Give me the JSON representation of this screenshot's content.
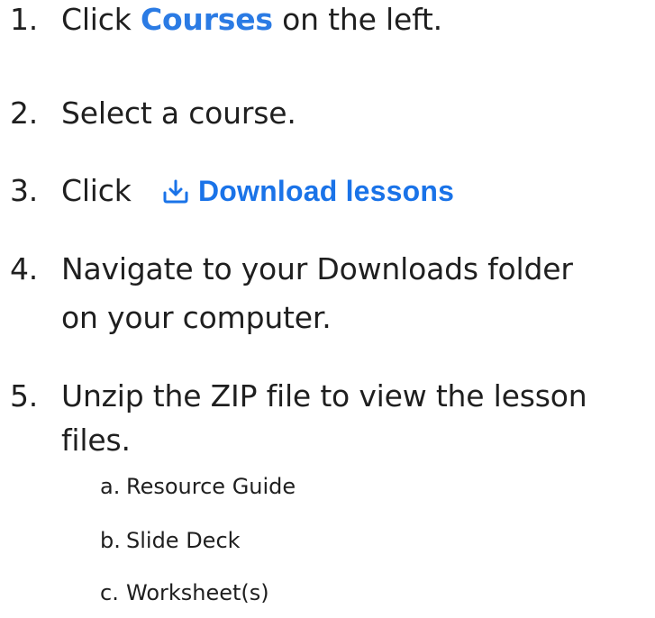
{
  "steps": [
    {
      "num": "1.",
      "pre": "Click ",
      "link": "Courses",
      "post": " on the left."
    },
    {
      "num": "2.",
      "text": "Select a course."
    },
    {
      "num": "3.",
      "text": "Click",
      "button": {
        "label": "Download lessons",
        "icon": "download-icon"
      }
    },
    {
      "num": "4.",
      "line1": "Navigate to your Downloads folder",
      "line2": "on your computer."
    },
    {
      "num": "5.",
      "line1": "Unzip the ZIP file to view the lesson",
      "line2": "files."
    }
  ],
  "subitems": [
    {
      "letter": "a.",
      "text": "Resource Guide"
    },
    {
      "letter": "b.",
      "text": "Slide Deck"
    },
    {
      "letter": "c.",
      "text": "Worksheet(s)"
    }
  ],
  "colors": {
    "text": "#1f1f1f",
    "courses_link": "#2b7be4",
    "download_button": "#1a73e8"
  }
}
